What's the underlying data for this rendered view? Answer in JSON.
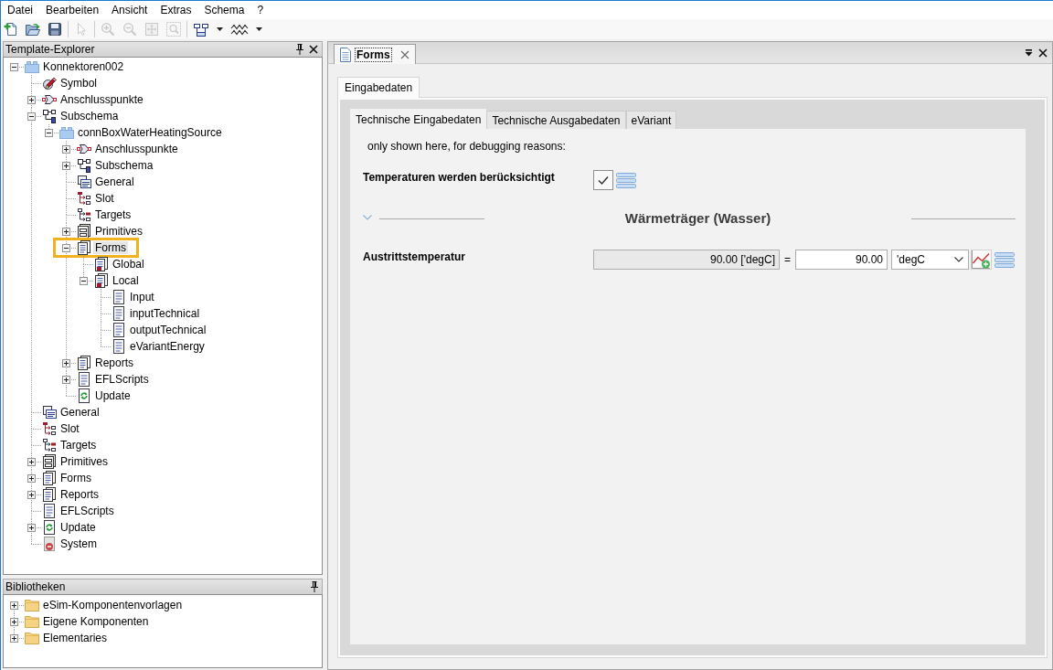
{
  "menu": [
    "Datei",
    "Bearbeiten",
    "Ansicht",
    "Extras",
    "Schema",
    "?"
  ],
  "toolbar": {
    "groups": [
      {
        "buttons": [
          {
            "kind": "new",
            "disabled": false,
            "dropdown": false
          },
          {
            "kind": "open",
            "disabled": false,
            "dropdown": false
          },
          {
            "kind": "save",
            "disabled": false,
            "dropdown": false
          }
        ]
      },
      {
        "buttons": [
          {
            "kind": "pointer",
            "disabled": true,
            "dropdown": false
          }
        ]
      },
      {
        "buttons": [
          {
            "kind": "zoom_in",
            "disabled": true,
            "dropdown": false
          },
          {
            "kind": "zoom_out",
            "disabled": true,
            "dropdown": false
          },
          {
            "kind": "zoom_fit",
            "disabled": true,
            "dropdown": false
          },
          {
            "kind": "zoom_area",
            "disabled": true,
            "dropdown": false
          }
        ]
      },
      {
        "buttons": [
          {
            "kind": "layout",
            "disabled": false,
            "dropdown": true
          },
          {
            "kind": "wave",
            "disabled": false,
            "dropdown": true
          }
        ]
      }
    ]
  },
  "explorer": {
    "title": "Template-Explorer",
    "items": [
      {
        "label": "Konnektoren002",
        "kind": "component",
        "expanded": true,
        "selected": false,
        "highlighted": false,
        "children": [
          {
            "label": "Symbol",
            "kind": "symbol",
            "selected": false,
            "highlighted": false
          },
          {
            "label": "Anschlusspunkte",
            "kind": "ports",
            "expanded": false,
            "selected": false,
            "highlighted": false
          },
          {
            "label": "Subschema",
            "kind": "subschema",
            "expanded": true,
            "selected": false,
            "highlighted": false,
            "children": [
              {
                "label": "connBoxWaterHeatingSource",
                "kind": "component",
                "expanded": true,
                "selected": false,
                "highlighted": false,
                "children": [
                  {
                    "label": "Anschlusspunkte",
                    "kind": "ports",
                    "expanded": false,
                    "selected": false,
                    "highlighted": false
                  },
                  {
                    "label": "Subschema",
                    "kind": "subschema",
                    "expanded": false,
                    "selected": false,
                    "highlighted": false
                  },
                  {
                    "label": "General",
                    "kind": "general",
                    "selected": false,
                    "highlighted": false
                  },
                  {
                    "label": "Slot",
                    "kind": "slot",
                    "selected": false,
                    "highlighted": false
                  },
                  {
                    "label": "Targets",
                    "kind": "targets",
                    "selected": false,
                    "highlighted": false
                  },
                  {
                    "label": "Primitives",
                    "kind": "primitives",
                    "expanded": false,
                    "selected": false,
                    "highlighted": false
                  },
                  {
                    "label": "Forms",
                    "kind": "forms",
                    "expanded": true,
                    "selected": true,
                    "highlighted": true,
                    "children": [
                      {
                        "label": "Global",
                        "kind": "formgroup",
                        "selected": false,
                        "highlighted": false
                      },
                      {
                        "label": "Local",
                        "kind": "formgroup",
                        "expanded": true,
                        "selected": false,
                        "highlighted": false,
                        "children": [
                          {
                            "label": "Input",
                            "kind": "form",
                            "selected": false,
                            "highlighted": false
                          },
                          {
                            "label": "inputTechnical",
                            "kind": "form",
                            "selected": false,
                            "highlighted": false
                          },
                          {
                            "label": "outputTechnical",
                            "kind": "form",
                            "selected": false,
                            "highlighted": false
                          },
                          {
                            "label": "eVariantEnergy",
                            "kind": "form",
                            "selected": false,
                            "highlighted": false
                          }
                        ]
                      }
                    ]
                  },
                  {
                    "label": "Reports",
                    "kind": "reports",
                    "expanded": false,
                    "selected": false,
                    "highlighted": false
                  },
                  {
                    "label": "EFLScripts",
                    "kind": "scripts",
                    "expanded": false,
                    "selected": false,
                    "highlighted": false
                  },
                  {
                    "label": "Update",
                    "kind": "update",
                    "selected": false,
                    "highlighted": false
                  }
                ]
              }
            ]
          },
          {
            "label": "General",
            "kind": "general",
            "selected": false,
            "highlighted": false
          },
          {
            "label": "Slot",
            "kind": "slot",
            "selected": false,
            "highlighted": false
          },
          {
            "label": "Targets",
            "kind": "targets",
            "selected": false,
            "highlighted": false
          },
          {
            "label": "Primitives",
            "kind": "primitives",
            "expanded": false,
            "selected": false,
            "highlighted": false
          },
          {
            "label": "Forms",
            "kind": "forms",
            "expanded": false,
            "selected": false,
            "highlighted": false
          },
          {
            "label": "Reports",
            "kind": "reports",
            "expanded": false,
            "selected": false,
            "highlighted": false
          },
          {
            "label": "EFLScripts",
            "kind": "scripts",
            "selected": false,
            "highlighted": false
          },
          {
            "label": "Update",
            "kind": "update",
            "expanded": false,
            "selected": false,
            "highlighted": false
          },
          {
            "label": "System",
            "kind": "system",
            "selected": false,
            "highlighted": false
          }
        ]
      }
    ]
  },
  "libraries": {
    "title": "Bibliotheken",
    "items": [
      {
        "label": "eSim-Komponentenvorlagen",
        "kind": "folder",
        "expanded": false,
        "selected": false
      },
      {
        "label": "Eigene Komponenten",
        "kind": "folder",
        "expanded": false,
        "selected": false
      },
      {
        "label": "Elementaries",
        "kind": "folder",
        "expanded": false,
        "selected": false
      }
    ]
  },
  "document": {
    "tabs": [
      {
        "label": "Forms",
        "selected": true
      }
    ]
  },
  "form": {
    "tabs": [
      {
        "label": "Eingabedaten",
        "selected": true
      }
    ],
    "subtabs": [
      {
        "label": "Technische Eingabedaten",
        "selected": true
      },
      {
        "label": "Technische Ausgabedaten",
        "selected": false
      },
      {
        "label": "eVariant",
        "selected": false
      }
    ],
    "note": "only shown here, for debugging reasons:",
    "rows": [
      {
        "kind": "checkbox",
        "label": "Temperaturen werden berücksichtigt",
        "checked": true
      },
      {
        "kind": "section",
        "title": "Wärmeträger (Wasser)",
        "expanded": true
      },
      {
        "kind": "quantity",
        "label": "Austrittstemperatur",
        "computed": "90.00 ['degC]",
        "relation": "=",
        "value": "90.00",
        "unit": "'degC"
      }
    ]
  }
}
